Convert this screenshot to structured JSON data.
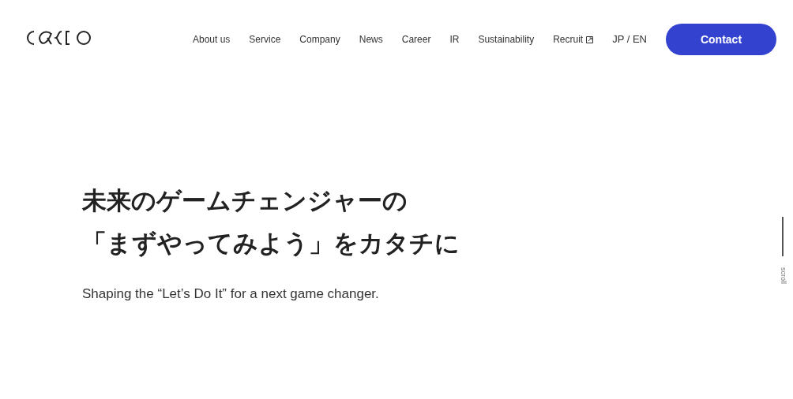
{
  "header": {
    "nav": [
      {
        "label": "About us",
        "external": false
      },
      {
        "label": "Service",
        "external": false
      },
      {
        "label": "Company",
        "external": false
      },
      {
        "label": "News",
        "external": false
      },
      {
        "label": "Career",
        "external": false
      },
      {
        "label": "IR",
        "external": false
      },
      {
        "label": "Sustainability",
        "external": false
      },
      {
        "label": "Recruit",
        "external": true
      }
    ],
    "language": "JP / EN",
    "contact_button": "Contact"
  },
  "hero": {
    "headline": [
      "未来のゲームチェンジャーの",
      "「まずやってみよう」をカタチに"
    ],
    "tagline": "Shaping the “Let’s Do It” for a next game changer."
  },
  "scroll_indicator": "scroll"
}
